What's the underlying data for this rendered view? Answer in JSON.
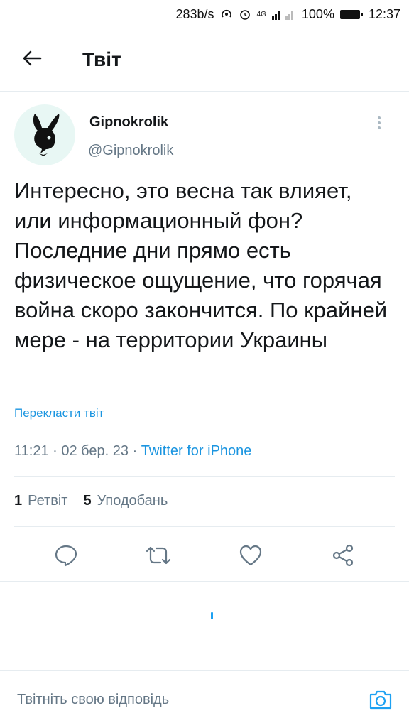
{
  "status_bar": {
    "speed": "283b/s",
    "network": "4G",
    "battery": "100%",
    "time": "12:37"
  },
  "header": {
    "title": "Твіт"
  },
  "tweet": {
    "author_name": "Gipnokrolik",
    "author_handle": "@Gipnokrolik",
    "text": "Интересно, это весна так влияет, или информационный фон? Последние дни прямо есть физическое ощущение, что горячая война скоро закончится. По крайней мере - на территории Украины",
    "translate_label": "Перекласти твіт",
    "time": "11:21",
    "date": "02 бер. 23",
    "source": "Twitter for iPhone",
    "retweets_count": "1",
    "retweets_label": "Ретвіт",
    "likes_count": "5",
    "likes_label": "Уподобань"
  },
  "reply": {
    "placeholder": "Твітніть свою відповідь"
  },
  "icons": {
    "back": "arrow-left-icon",
    "more": "more-vertical-icon",
    "reply": "reply-icon",
    "retweet": "retweet-icon",
    "like": "heart-icon",
    "share": "share-icon",
    "camera": "camera-icon"
  },
  "colors": {
    "accent": "#1da1f2",
    "link": "#1b95e0",
    "muted": "#657786"
  }
}
